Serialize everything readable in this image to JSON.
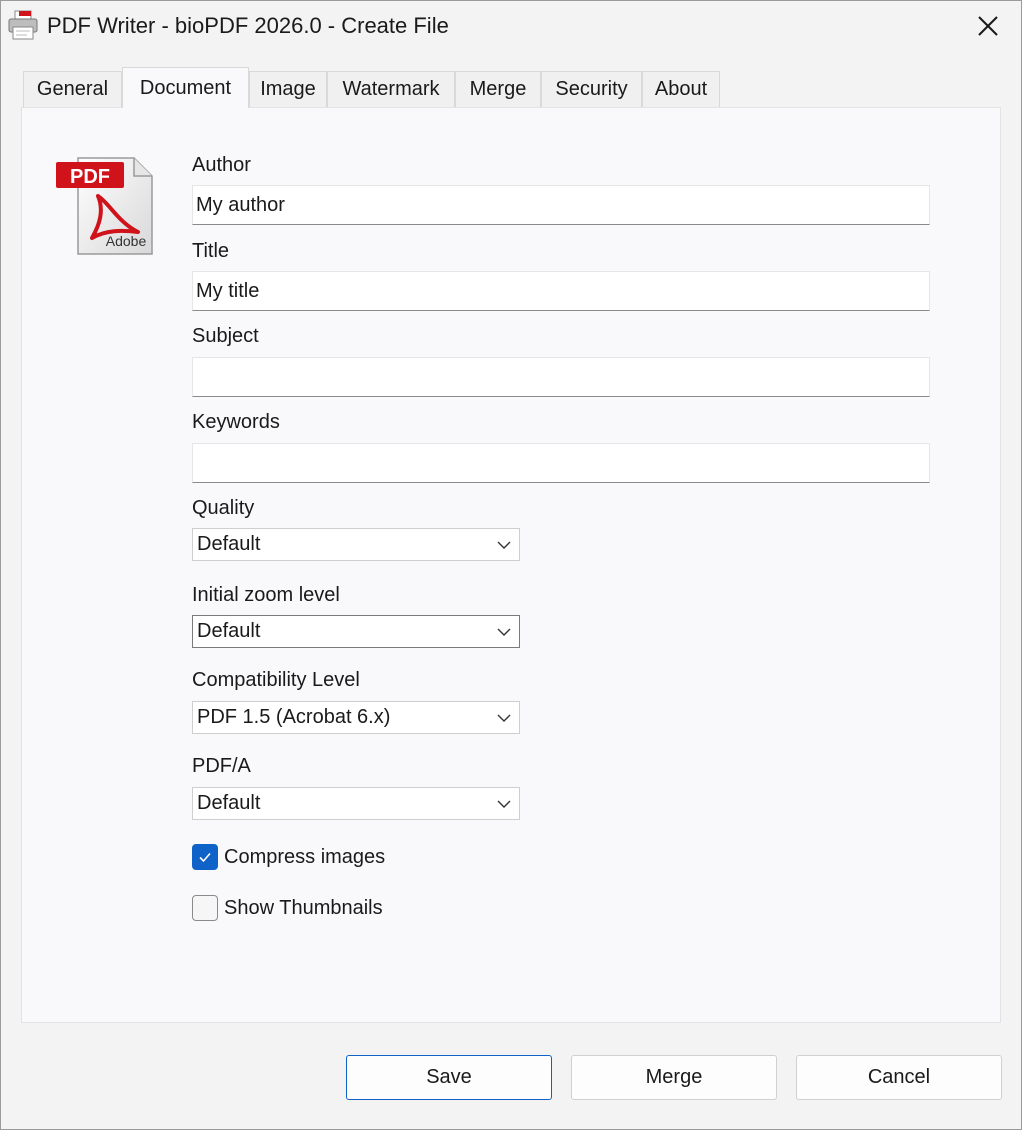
{
  "window": {
    "title": "PDF Writer - bioPDF 2026.0 - Create File",
    "app_icon": "printer-pdf-icon",
    "close_icon": "close-icon"
  },
  "tabs": [
    {
      "label": "General",
      "active": false
    },
    {
      "label": "Document",
      "active": true
    },
    {
      "label": "Image",
      "active": false
    },
    {
      "label": "Watermark",
      "active": false
    },
    {
      "label": "Merge",
      "active": false
    },
    {
      "label": "Security",
      "active": false
    },
    {
      "label": "About",
      "active": false
    }
  ],
  "document": {
    "logo": {
      "icon": "adobe-pdf-file-icon",
      "badge_text": "PDF",
      "brand_text": "Adobe"
    },
    "author": {
      "label": "Author",
      "value": "My author"
    },
    "title": {
      "label": "Title",
      "value": "My title"
    },
    "subject": {
      "label": "Subject",
      "value": ""
    },
    "keywords": {
      "label": "Keywords",
      "value": ""
    },
    "quality": {
      "label": "Quality",
      "selected": "Default"
    },
    "zoom": {
      "label": "Initial zoom level",
      "selected": "Default"
    },
    "compatibility": {
      "label": "Compatibility Level",
      "selected": "PDF 1.5 (Acrobat 6.x)"
    },
    "pdfa": {
      "label": "PDF/A",
      "selected": "Default"
    },
    "compress_images": {
      "label": "Compress images",
      "checked": true
    },
    "show_thumbnails": {
      "label": "Show Thumbnails",
      "checked": false
    }
  },
  "buttons": {
    "save": "Save",
    "merge": "Merge",
    "cancel": "Cancel"
  },
  "colors": {
    "accent": "#0f63c8",
    "pdf_red": "#d0121b"
  }
}
